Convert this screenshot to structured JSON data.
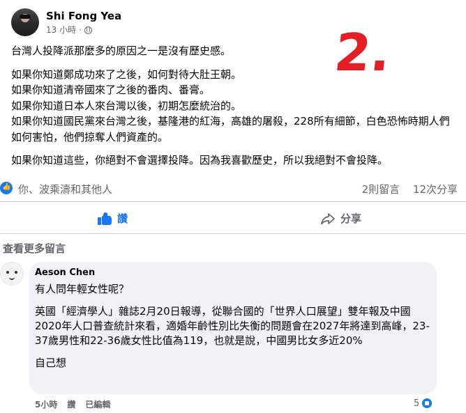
{
  "post": {
    "author": "Shi Fong Yea",
    "time": "13 小時",
    "separator": "·",
    "overlay_number": "2.",
    "paragraphs": [
      "台灣人投降派那麼多的原因之一是沒有歷史感。",
      "如果你知道鄭成功來了之後，如何對待大肚王朝。",
      "如果你知道清帝國來了之後的番肉、番膏。",
      "如果你知道日本人來台灣以後，初期怎麼統治的。",
      "如果你知道國民黨來台灣之後，基隆港的紅海，高雄的屠殺，228所有細節，白色恐怖時期人們如何害怕，他們掠奪人們資產的。",
      "如果你知道這些，你絕對不會選擇投降。因為我喜歡歷史，所以我絕對不會投降。"
    ],
    "reactions_text": "你、波乘濤和其他人",
    "comments_count": "2則留言",
    "shares_count": "12次分享"
  },
  "actions": {
    "like_label": "讚",
    "share_label": "分享"
  },
  "comments_section": {
    "more_label": "查看更多留言"
  },
  "comment": {
    "author": "Aeson Chen",
    "lines": [
      "有人問年輕女性呢？",
      "英國「經濟學人」雜誌2月20日報導，從聯合國的「世界人口展望」雙年報及中國2020年人口普查統計來看，適婚年齡性別比失衡的問題會在2027年將達到高峰，23-37歲男性和22-36歲女性比值為119，也就是說，中國男比女多近20%",
      "自己想"
    ],
    "time": "5小時",
    "like_action": "讚",
    "edited": "已編輯",
    "like_count": "5"
  },
  "colors": {
    "accent": "#1877f2",
    "overlay_red": "#e31e24",
    "secondary_text": "#65676b",
    "bubble_bg": "#f0f2f5"
  }
}
